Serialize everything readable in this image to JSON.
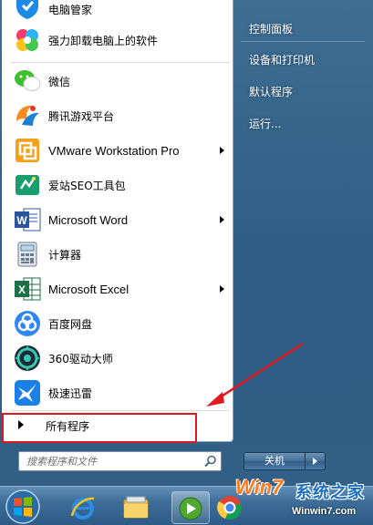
{
  "programs": [
    {
      "label": "电脑管家",
      "icon": "tencent-pc-manager-icon",
      "has_submenu": false
    },
    {
      "label": "强力卸载电脑上的软件",
      "icon": "uninstaller-icon",
      "has_submenu": false
    },
    {
      "label": "微信",
      "icon": "wechat-icon",
      "has_submenu": false
    },
    {
      "label": "腾讯游戏平台",
      "icon": "tencent-games-icon",
      "has_submenu": false
    },
    {
      "label": "VMware Workstation Pro",
      "icon": "vmware-icon",
      "has_submenu": true
    },
    {
      "label": "爱站SEO工具包",
      "icon": "aizhan-seo-icon",
      "has_submenu": false
    },
    {
      "label": "Microsoft Word",
      "icon": "word-icon",
      "has_submenu": true
    },
    {
      "label": "计算器",
      "icon": "calculator-icon",
      "has_submenu": false
    },
    {
      "label": "Microsoft Excel",
      "icon": "excel-icon",
      "has_submenu": true
    },
    {
      "label": "百度网盘",
      "icon": "baidu-netdisk-icon",
      "has_submenu": false
    },
    {
      "label": "360驱动大师",
      "icon": "360-driver-icon",
      "has_submenu": false
    },
    {
      "label": "极速迅雷",
      "icon": "xunlei-icon",
      "has_submenu": false
    }
  ],
  "all_programs_label": "所有程序",
  "search": {
    "placeholder": "搜索程序和文件"
  },
  "right_pane": {
    "items": [
      "控制面板",
      "设备和打印机",
      "默认程序",
      "运行..."
    ]
  },
  "shutdown": {
    "label": "关机"
  },
  "taskbar": {
    "items": [
      "start-button",
      "internet-explorer",
      "windows-explorer",
      "media-player",
      "chrome"
    ]
  },
  "watermark": {
    "brand": "Win7",
    "brand_cn": "系统之家",
    "url": "Winwin7.com"
  },
  "colors": {
    "highlight": "#e0191f",
    "arrow": "#e0191f",
    "pane_bg": "#2f5e87"
  }
}
